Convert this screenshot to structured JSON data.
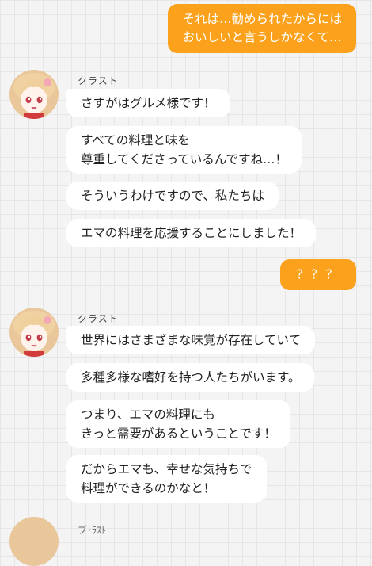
{
  "messages_right": [
    {
      "text": "それは…勧められたからには\nおいしいと言うしかなくて…"
    },
    {
      "text": "？？？"
    }
  ],
  "groups": [
    {
      "speaker": "クラスト",
      "bubbles": [
        "さすがはグルメ様です！",
        "すべての料理と味を\n尊重してくださっているんですね…！",
        "そういうわけですので、私たちは",
        "エマの料理を応援することにしました！"
      ]
    },
    {
      "speaker": "クラスト",
      "bubbles": [
        "世界にはさまざまな味覚が存在していて",
        "多種多様な嗜好を持つ人たちがいます。",
        "つまり、エマの料理にも\nきっと需要があるということです！",
        "だからエマも、幸せな気持ちで\n料理ができるのかなと！"
      ]
    }
  ],
  "partial_speaker": "ブ･ﾗｽﾄ",
  "colors": {
    "accent": "#fba11c",
    "bubble": "#ffffff",
    "background": "#f4f4f4"
  }
}
